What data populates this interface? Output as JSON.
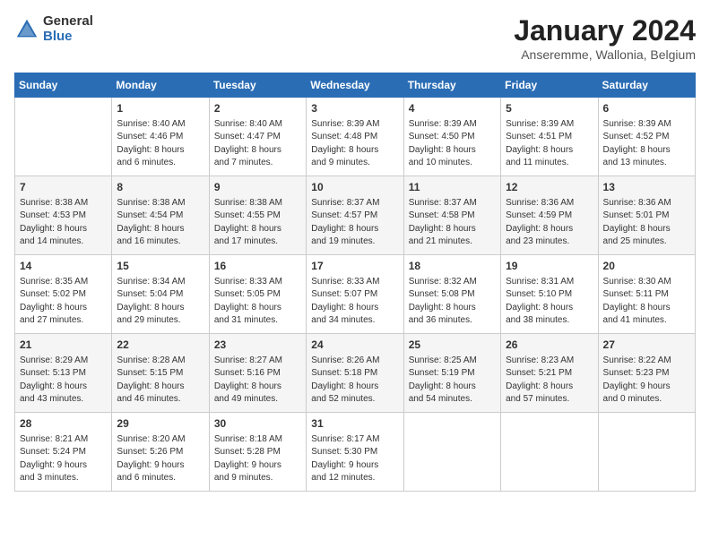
{
  "header": {
    "logo_general": "General",
    "logo_blue": "Blue",
    "month_title": "January 2024",
    "subtitle": "Anseremme, Wallonia, Belgium"
  },
  "days_of_week": [
    "Sunday",
    "Monday",
    "Tuesday",
    "Wednesday",
    "Thursday",
    "Friday",
    "Saturday"
  ],
  "weeks": [
    {
      "days": [
        {
          "num": "",
          "info": ""
        },
        {
          "num": "1",
          "info": "Sunrise: 8:40 AM\nSunset: 4:46 PM\nDaylight: 8 hours\nand 6 minutes."
        },
        {
          "num": "2",
          "info": "Sunrise: 8:40 AM\nSunset: 4:47 PM\nDaylight: 8 hours\nand 7 minutes."
        },
        {
          "num": "3",
          "info": "Sunrise: 8:39 AM\nSunset: 4:48 PM\nDaylight: 8 hours\nand 9 minutes."
        },
        {
          "num": "4",
          "info": "Sunrise: 8:39 AM\nSunset: 4:50 PM\nDaylight: 8 hours\nand 10 minutes."
        },
        {
          "num": "5",
          "info": "Sunrise: 8:39 AM\nSunset: 4:51 PM\nDaylight: 8 hours\nand 11 minutes."
        },
        {
          "num": "6",
          "info": "Sunrise: 8:39 AM\nSunset: 4:52 PM\nDaylight: 8 hours\nand 13 minutes."
        }
      ]
    },
    {
      "days": [
        {
          "num": "7",
          "info": "Sunrise: 8:38 AM\nSunset: 4:53 PM\nDaylight: 8 hours\nand 14 minutes."
        },
        {
          "num": "8",
          "info": "Sunrise: 8:38 AM\nSunset: 4:54 PM\nDaylight: 8 hours\nand 16 minutes."
        },
        {
          "num": "9",
          "info": "Sunrise: 8:38 AM\nSunset: 4:55 PM\nDaylight: 8 hours\nand 17 minutes."
        },
        {
          "num": "10",
          "info": "Sunrise: 8:37 AM\nSunset: 4:57 PM\nDaylight: 8 hours\nand 19 minutes."
        },
        {
          "num": "11",
          "info": "Sunrise: 8:37 AM\nSunset: 4:58 PM\nDaylight: 8 hours\nand 21 minutes."
        },
        {
          "num": "12",
          "info": "Sunrise: 8:36 AM\nSunset: 4:59 PM\nDaylight: 8 hours\nand 23 minutes."
        },
        {
          "num": "13",
          "info": "Sunrise: 8:36 AM\nSunset: 5:01 PM\nDaylight: 8 hours\nand 25 minutes."
        }
      ]
    },
    {
      "days": [
        {
          "num": "14",
          "info": "Sunrise: 8:35 AM\nSunset: 5:02 PM\nDaylight: 8 hours\nand 27 minutes."
        },
        {
          "num": "15",
          "info": "Sunrise: 8:34 AM\nSunset: 5:04 PM\nDaylight: 8 hours\nand 29 minutes."
        },
        {
          "num": "16",
          "info": "Sunrise: 8:33 AM\nSunset: 5:05 PM\nDaylight: 8 hours\nand 31 minutes."
        },
        {
          "num": "17",
          "info": "Sunrise: 8:33 AM\nSunset: 5:07 PM\nDaylight: 8 hours\nand 34 minutes."
        },
        {
          "num": "18",
          "info": "Sunrise: 8:32 AM\nSunset: 5:08 PM\nDaylight: 8 hours\nand 36 minutes."
        },
        {
          "num": "19",
          "info": "Sunrise: 8:31 AM\nSunset: 5:10 PM\nDaylight: 8 hours\nand 38 minutes."
        },
        {
          "num": "20",
          "info": "Sunrise: 8:30 AM\nSunset: 5:11 PM\nDaylight: 8 hours\nand 41 minutes."
        }
      ]
    },
    {
      "days": [
        {
          "num": "21",
          "info": "Sunrise: 8:29 AM\nSunset: 5:13 PM\nDaylight: 8 hours\nand 43 minutes."
        },
        {
          "num": "22",
          "info": "Sunrise: 8:28 AM\nSunset: 5:15 PM\nDaylight: 8 hours\nand 46 minutes."
        },
        {
          "num": "23",
          "info": "Sunrise: 8:27 AM\nSunset: 5:16 PM\nDaylight: 8 hours\nand 49 minutes."
        },
        {
          "num": "24",
          "info": "Sunrise: 8:26 AM\nSunset: 5:18 PM\nDaylight: 8 hours\nand 52 minutes."
        },
        {
          "num": "25",
          "info": "Sunrise: 8:25 AM\nSunset: 5:19 PM\nDaylight: 8 hours\nand 54 minutes."
        },
        {
          "num": "26",
          "info": "Sunrise: 8:23 AM\nSunset: 5:21 PM\nDaylight: 8 hours\nand 57 minutes."
        },
        {
          "num": "27",
          "info": "Sunrise: 8:22 AM\nSunset: 5:23 PM\nDaylight: 9 hours\nand 0 minutes."
        }
      ]
    },
    {
      "days": [
        {
          "num": "28",
          "info": "Sunrise: 8:21 AM\nSunset: 5:24 PM\nDaylight: 9 hours\nand 3 minutes."
        },
        {
          "num": "29",
          "info": "Sunrise: 8:20 AM\nSunset: 5:26 PM\nDaylight: 9 hours\nand 6 minutes."
        },
        {
          "num": "30",
          "info": "Sunrise: 8:18 AM\nSunset: 5:28 PM\nDaylight: 9 hours\nand 9 minutes."
        },
        {
          "num": "31",
          "info": "Sunrise: 8:17 AM\nSunset: 5:30 PM\nDaylight: 9 hours\nand 12 minutes."
        },
        {
          "num": "",
          "info": ""
        },
        {
          "num": "",
          "info": ""
        },
        {
          "num": "",
          "info": ""
        }
      ]
    }
  ]
}
